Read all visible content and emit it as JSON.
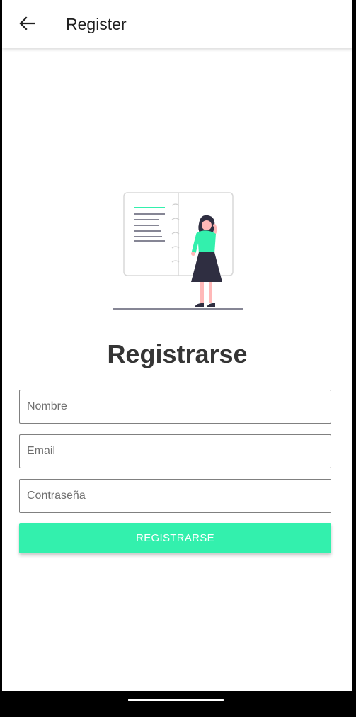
{
  "app_bar": {
    "title": "Register",
    "back_icon": "arrow-left-icon"
  },
  "illustration": {
    "icon": "person-with-notebook-illustration",
    "accent_color": "#33f0ad"
  },
  "form": {
    "heading": "Registrarse",
    "name_placeholder": "Nombre",
    "email_placeholder": "Email",
    "password_placeholder": "Contraseña",
    "submit_label": "REGISTRARSE"
  },
  "colors": {
    "accent": "#33f0ad",
    "heading": "#353535",
    "border": "#808080"
  }
}
